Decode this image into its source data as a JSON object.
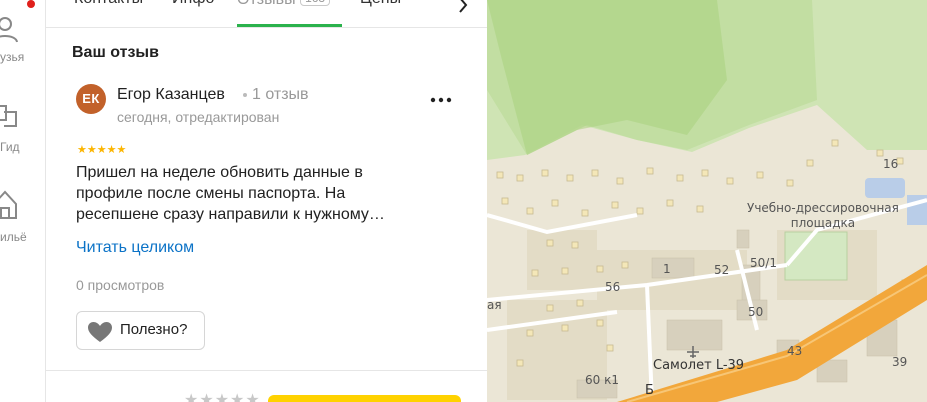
{
  "sidebar": {
    "items": [
      {
        "label": "узья",
        "icon": "friends-icon"
      },
      {
        "label": "Гид",
        "icon": "guide-icon"
      },
      {
        "label": "ильё",
        "icon": "housing-icon"
      }
    ]
  },
  "tabs": [
    {
      "label": "Контакты"
    },
    {
      "label": "Инфо"
    },
    {
      "label": "Отзывы",
      "count": "163",
      "active": true
    },
    {
      "label": "Цены"
    }
  ],
  "review_section": {
    "title": "Ваш отзыв",
    "author": {
      "initials": "ЕК",
      "name": "Егор Казанцев",
      "reviews_count": "1 отзыв"
    },
    "date": "сегодня, отредактирован",
    "rating": 5,
    "stars": "★★★★★",
    "text_lines": [
      "Пришел на неделе обновить данные в",
      "профиле после смены паспорта. На",
      "ресепшене сразу направили к нужному…"
    ],
    "read_more": "Читать целиком",
    "views": "0 просмотров",
    "useful_label": "Полезно?"
  },
  "rate_bar": {
    "stars": "★★★★★"
  },
  "map": {
    "labels": {
      "training_ground": [
        "Учебно-дрессировочная",
        "площадка"
      ],
      "plane": "Самолет L-39",
      "n16": "16",
      "n1": "1",
      "n52": "52",
      "n50_1": "50/1",
      "n56": "56",
      "n50": "50",
      "n43": "43",
      "n60k1": "60 к1",
      "n39": "39",
      "street_cut": "ая",
      "street_b": "Б"
    }
  },
  "colors": {
    "accent_green": "#2bb24c",
    "link_blue": "#0c73c7",
    "star_yellow": "#fcb500",
    "road_orange": "#f2a73b",
    "avatar_bg": "#c2612a"
  }
}
